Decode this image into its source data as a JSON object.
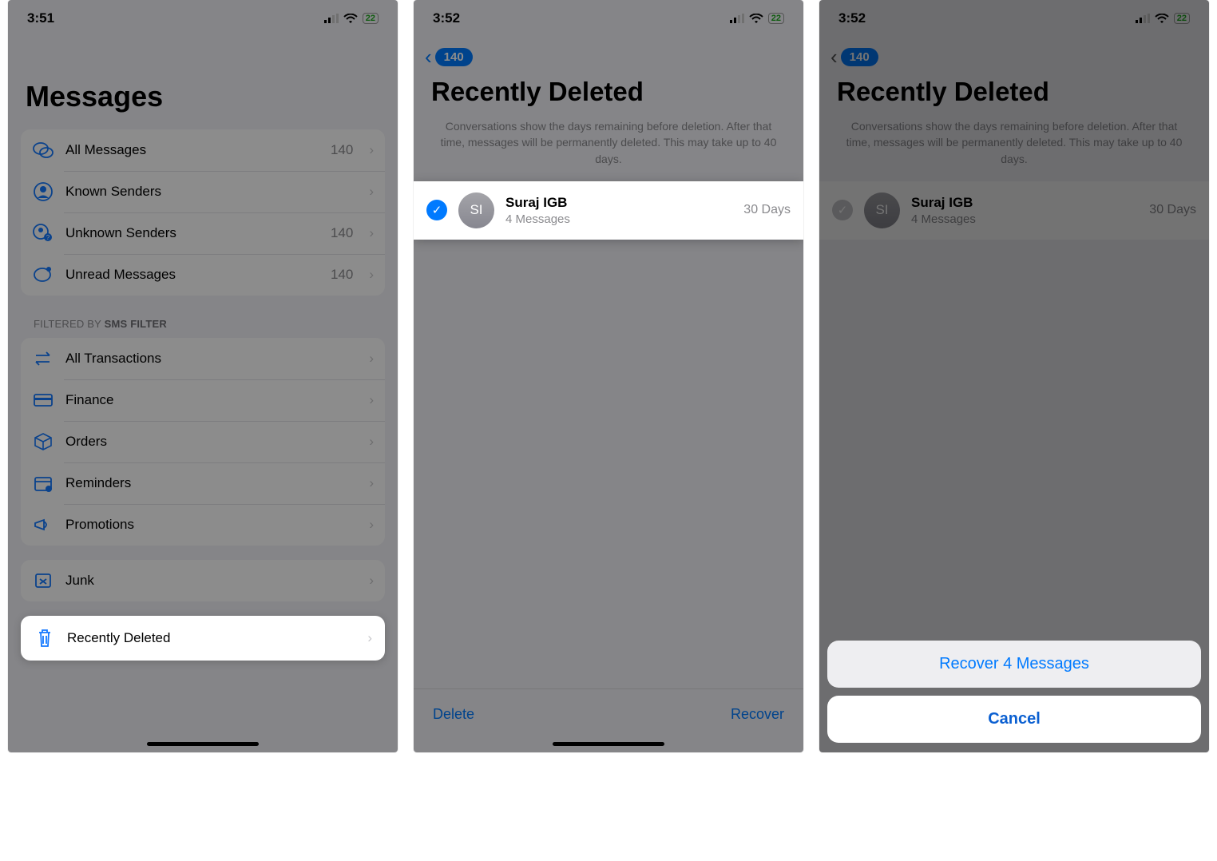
{
  "status_bar": {
    "time1": "3:51",
    "time2": "3:52",
    "time3": "3:52",
    "battery": "22"
  },
  "screen1": {
    "title": "Messages",
    "filters": [
      {
        "icon": "bubbles",
        "label": "All Messages",
        "count": "140"
      },
      {
        "icon": "person",
        "label": "Known Senders",
        "count": ""
      },
      {
        "icon": "personq",
        "label": "Unknown Senders",
        "count": "140"
      },
      {
        "icon": "bubbled",
        "label": "Unread Messages",
        "count": "140"
      }
    ],
    "section_label_prefix": "FILTERED BY ",
    "section_label_strong": "SMS FILTER",
    "categories": [
      {
        "icon": "swap",
        "label": "All Transactions"
      },
      {
        "icon": "card",
        "label": "Finance"
      },
      {
        "icon": "box",
        "label": "Orders"
      },
      {
        "icon": "cal",
        "label": "Reminders"
      },
      {
        "icon": "horn",
        "label": "Promotions"
      }
    ],
    "junk": {
      "label": "Junk"
    },
    "deleted": {
      "label": "Recently Deleted"
    }
  },
  "screen2": {
    "back_badge": "140",
    "title": "Recently Deleted",
    "info": "Conversations show the days remaining before deletion. After that time, messages will be permanently deleted. This may take up to 40 days.",
    "conv": {
      "initials": "SI",
      "name": "Suraj IGB",
      "sub": "4 Messages",
      "days": "30 Days"
    },
    "delete": "Delete",
    "recover": "Recover"
  },
  "screen3": {
    "back_badge": "140",
    "title": "Recently Deleted",
    "info": "Conversations show the days remaining before deletion. After that time, messages will be permanently deleted. This may take up to 40 days.",
    "conv": {
      "initials": "SI",
      "name": "Suraj IGB",
      "sub": "4 Messages",
      "days": "30 Days"
    },
    "sheet": {
      "recover": "Recover 4 Messages",
      "cancel": "Cancel"
    }
  }
}
